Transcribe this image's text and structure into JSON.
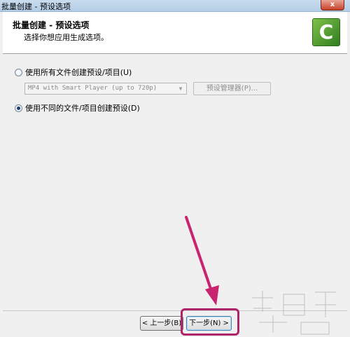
{
  "window": {
    "title": "批量创建 - 预设选项",
    "close_label": "x"
  },
  "header": {
    "title": "批量创建 - 预设选项",
    "subtitle": "选择你想应用生成选项。",
    "logo_letter": "C"
  },
  "options": {
    "all_files": {
      "label": "使用所有文件创建预设/项目(U)",
      "checked": false
    },
    "preset_select": {
      "value": "MP4 with Smart Player (up to 720p)"
    },
    "preset_manager_button": {
      "label": "预设管理器(P)...",
      "enabled": false
    },
    "different": {
      "label": "使用不同的文件/项目创建预设(D)",
      "checked": true
    }
  },
  "footer": {
    "prev_label": "< 上一步(B)",
    "next_label": "下一步(N) >"
  },
  "colors": {
    "annotation": "#c8246f",
    "logo": "#4fa331"
  },
  "icons": [
    "close-icon",
    "camtasia-logo-icon",
    "chevron-down-icon",
    "annotation-arrow-icon"
  ]
}
